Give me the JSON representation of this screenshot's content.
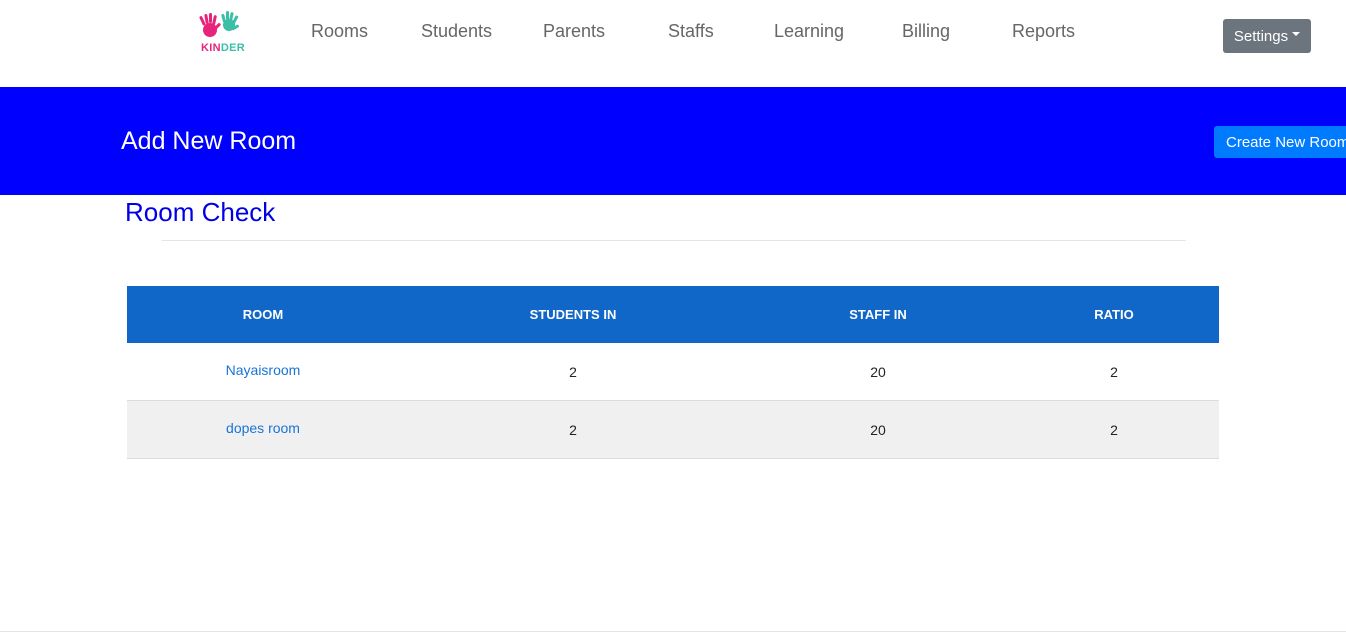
{
  "navbar": {
    "logo_text": "KINDER",
    "items": [
      {
        "label": "Rooms"
      },
      {
        "label": "Students"
      },
      {
        "label": "Parents"
      },
      {
        "label": "Staffs"
      },
      {
        "label": "Learning"
      },
      {
        "label": "Billing"
      },
      {
        "label": "Reports"
      }
    ],
    "settings_label": "Settings"
  },
  "hero": {
    "title": "Add New Room",
    "create_button": "Create New Room"
  },
  "section": {
    "title": "Room Check"
  },
  "table": {
    "headers": [
      "Room",
      "Students In",
      "Staff In",
      "Ratio"
    ],
    "rows": [
      {
        "room": "Nayaisroom",
        "students_in": "2",
        "staff_in": "20",
        "ratio": "2"
      },
      {
        "room": "dopes room",
        "students_in": "2",
        "staff_in": "20",
        "ratio": "2"
      }
    ]
  },
  "colors": {
    "hero_bg": "#0000ff",
    "table_header_bg": "#1167c8",
    "link": "#1a73d9",
    "settings_bg": "#6c757d",
    "create_btn_bg": "#007bff",
    "logo_pink": "#e8237c",
    "logo_teal": "#3bbfa7"
  },
  "icons": {
    "logo": "hands-logo-icon",
    "settings_caret": "caret-down-icon"
  }
}
